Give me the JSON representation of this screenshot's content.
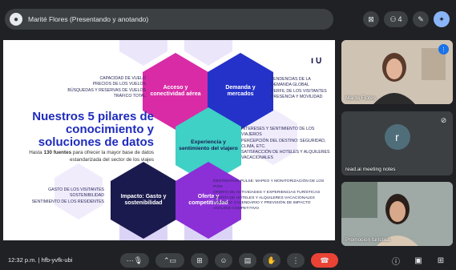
{
  "topbar": {
    "presenter": "Marité Flores (Presentando y anotando)",
    "participant_count": "4"
  },
  "slide": {
    "headline": "Nuestros 5 pilares de conocimiento y soluciones de datos",
    "subline_prefix": "Hasta ",
    "subline_bold": "130 fuentes",
    "subline_suffix": " para ofrecer la mayor base de datos estandarizada del sector de los viajes",
    "logo": "ı∪",
    "pillars": {
      "access": "Acceso y conectividad aérea",
      "demand": "Demanda y mercados",
      "experience": "Experiencia y sentimiento del viajero",
      "impact": "Impacto: Gasto y sostenibilidad",
      "offer": "Oferta y competitividad"
    },
    "labels": {
      "access": [
        "CAPACIDAD DE VUELO",
        "PRECIOS DE LOS VUELOS",
        "BÚSQUEDAS Y RESERVAS DE VUELOS",
        "TRÁFICO TOTAL"
      ],
      "demand": [
        "TENDENCIAS DE LA",
        "DEMANDA GLOBAL",
        "PERFIL DE LOS VISITANTES",
        "PRESENCIA Y MOVILIDAD"
      ],
      "experience": [
        "INTERESES Y SENTIMIENTO DE LOS VIAJEROS",
        "PERCEPCIÓN DEL DESTINO: SEGURIDAD,",
        "CLIMA, ETC.",
        "SATISFACCIÓN DE HOTELES Y ALQUILERES",
        "VACACIONALES"
      ],
      "impact": [
        "GASTO DE LOS VISITANTES",
        "SOSTENIBILIDAD",
        "SENTIMIENTO DE LOS RESIDENTES"
      ],
      "offer": [
        "DESTINATION PULSE: MAPEO Y MONITORIZACIÓN DE LOS POIs",
        "OFERTA DE ACTIVIDADES Y EXPERIENCIAS TURÍSTICAS",
        "OFERTA DE HOTELES Y ALQUILERES VACACIONALES",
        "EVENTOS: CALENDARIO Y PREVISIÓN DE IMPACTO",
        "ANÁLISIS COMPETITIVO"
      ]
    }
  },
  "participants": [
    {
      "name": "Marité Flores",
      "type": "video"
    },
    {
      "name": "read.ai meeting notes",
      "initial": "r",
      "type": "avatar"
    },
    {
      "name": "Promoción turística",
      "type": "video"
    }
  ],
  "bottombar": {
    "time": "12:32 p.m.",
    "separator": "|",
    "meeting_code": "hfb-yvfk-ubi"
  },
  "colors": {
    "magenta": "#d92ba6",
    "blue": "#2432c9",
    "teal": "#3fd0c6",
    "navy": "#1a1a4e",
    "purple": "#8b2fd6",
    "lavender": "#dcd4f7",
    "end_call": "#ea4335"
  }
}
